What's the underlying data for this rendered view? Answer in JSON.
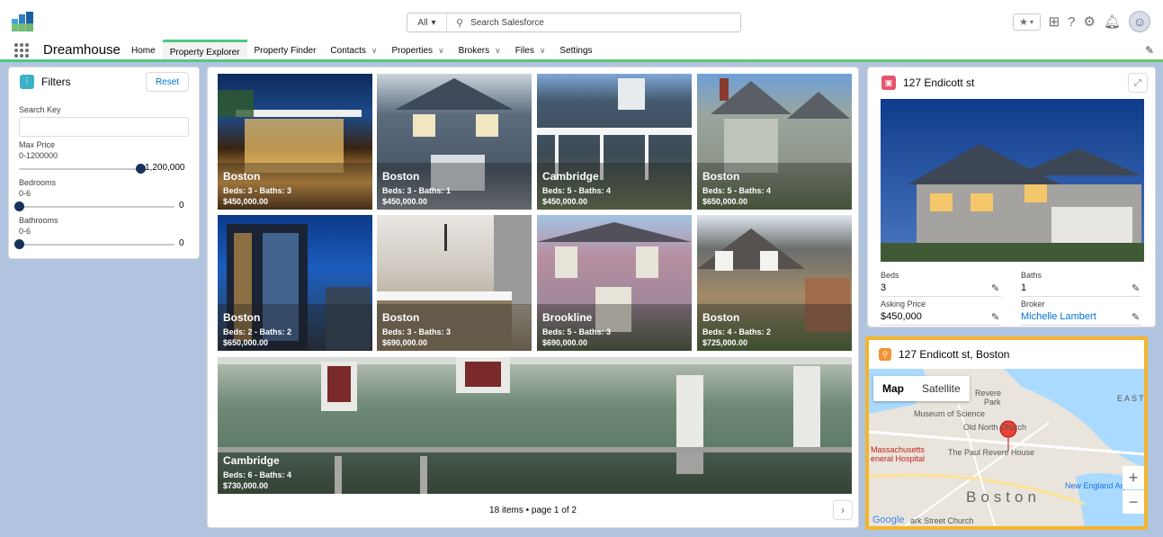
{
  "header": {
    "search_scope": "All",
    "search_placeholder": "Search Salesforce"
  },
  "nav": {
    "app_name": "Dreamhouse",
    "items": [
      {
        "label": "Home",
        "dropdown": false,
        "active": false
      },
      {
        "label": "Property Explorer",
        "dropdown": false,
        "active": true
      },
      {
        "label": "Property Finder",
        "dropdown": false,
        "active": false
      },
      {
        "label": "Contacts",
        "dropdown": true,
        "active": false
      },
      {
        "label": "Properties",
        "dropdown": true,
        "active": false
      },
      {
        "label": "Brokers",
        "dropdown": true,
        "active": false
      },
      {
        "label": "Files",
        "dropdown": true,
        "active": false
      },
      {
        "label": "Settings",
        "dropdown": false,
        "active": false
      }
    ]
  },
  "filters": {
    "title": "Filters",
    "reset_label": "Reset",
    "search_key_label": "Search Key",
    "search_key_value": "",
    "max_price_label": "Max Price",
    "max_price_range": "0-1200000",
    "max_price_value": "1,200,000",
    "max_price_fraction": 1.0,
    "bedrooms_label": "Bedrooms",
    "bedrooms_range": "0-6",
    "bedrooms_value": "0",
    "bedrooms_fraction": 0,
    "bathrooms_label": "Bathrooms",
    "bathrooms_range": "0-6",
    "bathrooms_value": "0",
    "bathrooms_fraction": 0
  },
  "properties": [
    {
      "city": "Boston",
      "details": "Beds: 3 - Baths: 3",
      "price": "$450,000.00"
    },
    {
      "city": "Boston",
      "details": "Beds: 3 - Baths: 1",
      "price": "$450,000.00"
    },
    {
      "city": "Cambridge",
      "details": "Beds: 5 - Baths: 4",
      "price": "$450,000.00"
    },
    {
      "city": "Boston",
      "details": "Beds: 5 - Baths: 4",
      "price": "$650,000.00"
    },
    {
      "city": "Boston",
      "details": "Beds: 2 - Baths: 2",
      "price": "$650,000.00"
    },
    {
      "city": "Boston",
      "details": "Beds: 3 - Baths: 3",
      "price": "$690,000.00"
    },
    {
      "city": "Brookline",
      "details": "Beds: 5 - Baths: 3",
      "price": "$690,000.00"
    },
    {
      "city": "Boston",
      "details": "Beds: 4 - Baths: 2",
      "price": "$725,000.00"
    },
    {
      "city": "Cambridge",
      "details": "Beds: 6 - Baths: 4",
      "price": "$730,000.00"
    }
  ],
  "pager": {
    "text": "18 items • page 1 of 2",
    "next_symbol": "›"
  },
  "detail": {
    "title": "127 Endicott st",
    "beds_label": "Beds",
    "beds_value": "3",
    "baths_label": "Baths",
    "baths_value": "1",
    "asking_price_label": "Asking Price",
    "asking_price_value": "$450,000",
    "broker_label": "Broker",
    "broker_value": "Michelle Lambert"
  },
  "map": {
    "title": "127 Endicott st, Boston",
    "toggle_map": "Map",
    "toggle_satellite": "Satellite",
    "labels": {
      "revere": "Revere",
      "park": "Park",
      "museum": "Museum of Science",
      "east": "EAST",
      "old_north": "Old North Church",
      "hospital_1": "Massachusetts",
      "hospital_2": "eneral Hospital",
      "revere_house": "The Paul Revere House",
      "aquarium": "New England Aquar",
      "boston": "Boston",
      "google": "Google",
      "park_street": "ark Street Church"
    },
    "zoom_in": "+",
    "zoom_out": "−"
  },
  "colors": {
    "accent_blue": "#0070d2",
    "nav_green": "#4bca81",
    "map_highlight": "#f4b52c",
    "page_bg": "#b0c4df"
  }
}
